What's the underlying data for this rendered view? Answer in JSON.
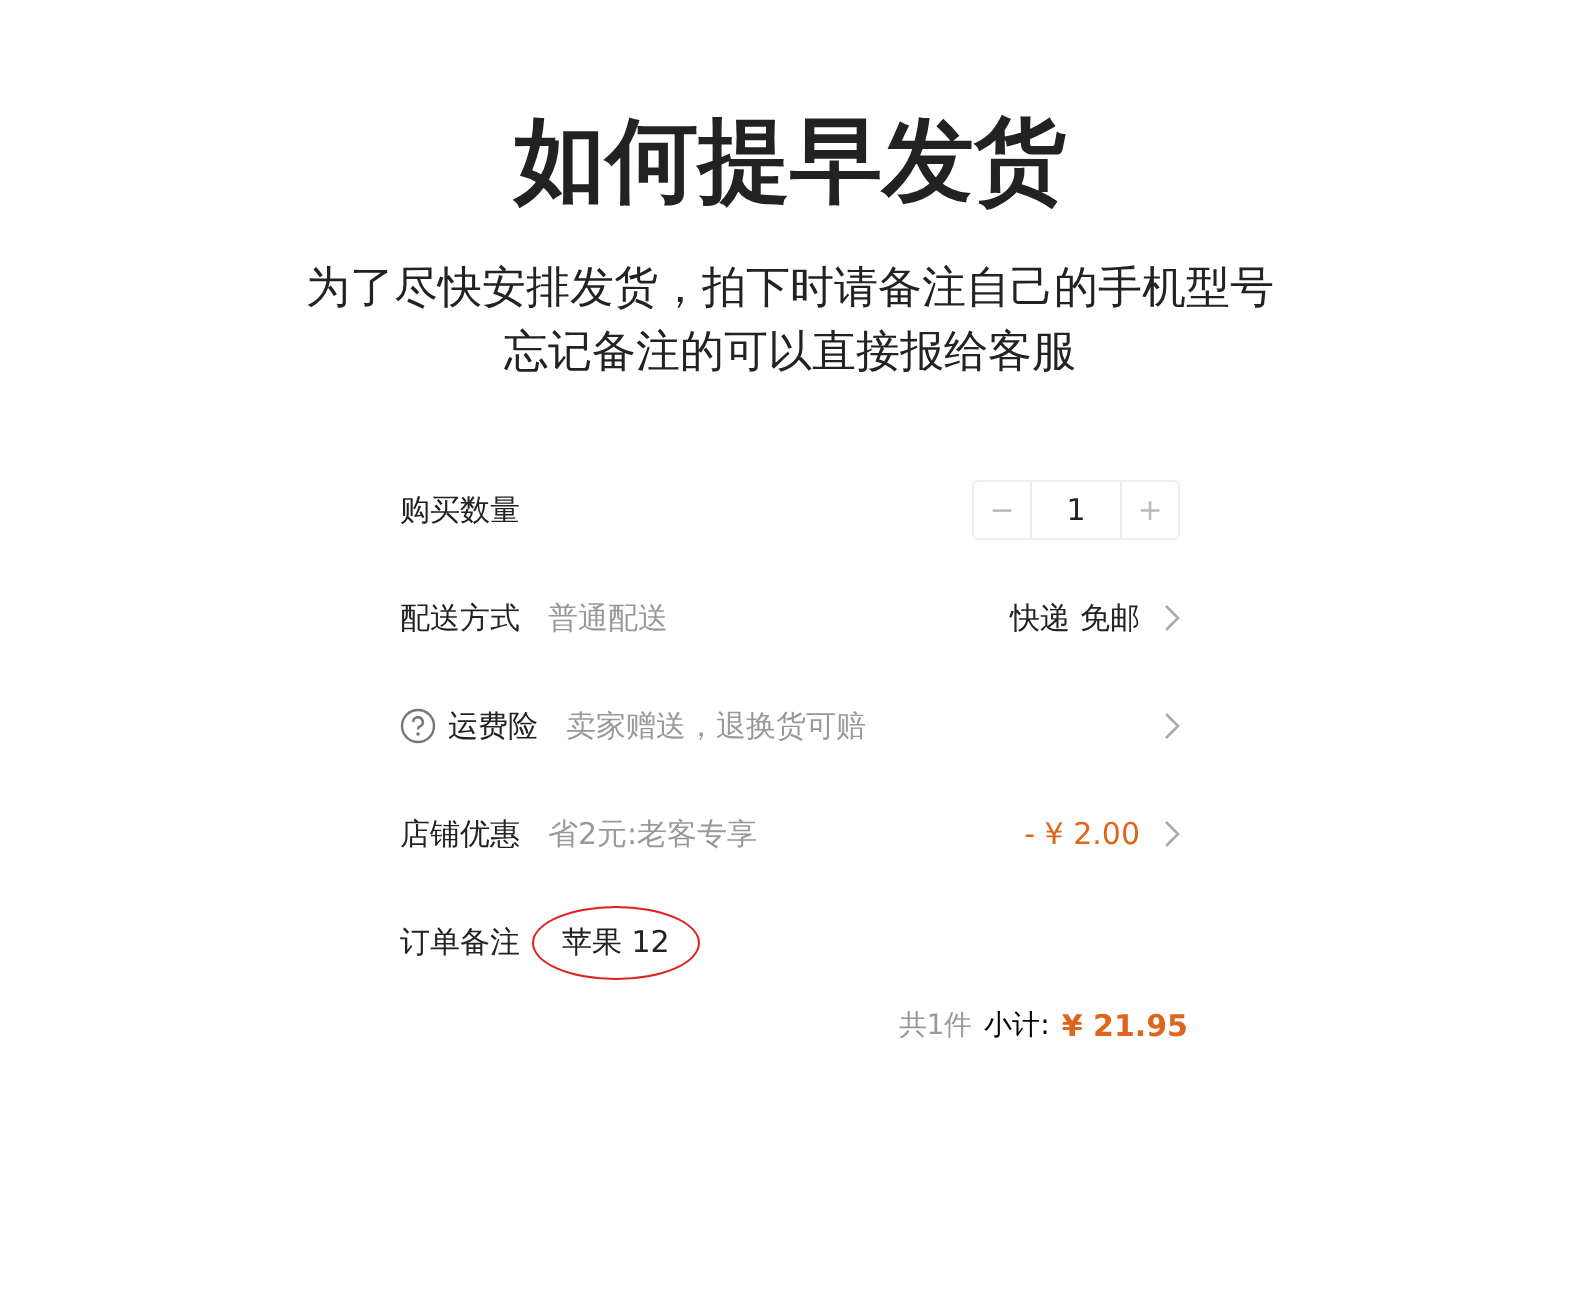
{
  "title": "如何提早发货",
  "subtitle": [
    "为了尽快安排发货，拍下时请备注自己的手机型号",
    "忘记备注的可以直接报给客服"
  ],
  "order_form": {
    "rows": [
      {
        "kind": "stepper",
        "label": "购买数量",
        "minus": "−",
        "value": "1",
        "plus": "+"
      },
      {
        "kind": "option",
        "label": "配送方式",
        "detail": "普通配送",
        "value": "快递 免邮",
        "chevron": true
      },
      {
        "kind": "option",
        "label": "运费险",
        "help": true,
        "detail": "卖家赠送，退换货可赔",
        "chevron": true
      },
      {
        "kind": "discount",
        "label": "店铺优惠",
        "detail": "省2元:老客专享",
        "value": "- ¥ 2.00",
        "chevron": true
      },
      {
        "kind": "note",
        "label": "订单备注",
        "value": "苹果 12",
        "circled": true
      }
    ],
    "summary": {
      "count": "共1件",
      "subtotal_label": "小计:",
      "subtotal": "¥ 21.95"
    }
  }
}
